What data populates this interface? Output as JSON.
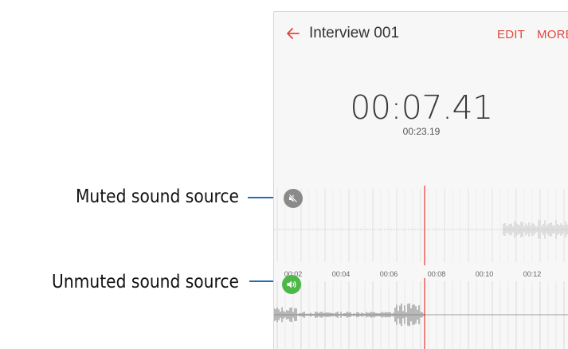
{
  "callouts": {
    "muted": "Muted sound source",
    "unmuted": "Unmuted sound source"
  },
  "appbar": {
    "back_icon": "arrow-left-icon",
    "title": "Interview 001",
    "edit_label": "EDIT",
    "more_label": "MORE"
  },
  "player": {
    "elapsed": "00:07.41",
    "total": "00:23.19"
  },
  "timeline": {
    "ticks": [
      "00:02",
      "00:04",
      "00:06",
      "00:08",
      "00:10",
      "00:12"
    ]
  },
  "tracks": [
    {
      "name": "muted-track",
      "state": "muted",
      "icon": "speaker-muted-icon"
    },
    {
      "name": "unmuted-track",
      "state": "unmuted",
      "icon": "speaker-icon"
    }
  ],
  "colors": {
    "accent": "#e0473b",
    "playhead": "#e53935",
    "callout_line": "#1f6fb5",
    "unmuted": "#4cb848",
    "muted": "#8a8a8a"
  }
}
